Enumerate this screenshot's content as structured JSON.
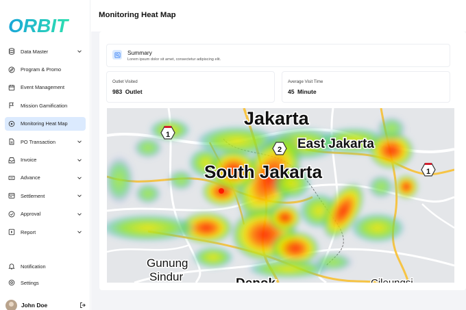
{
  "app": {
    "logo_text": "ORBIT"
  },
  "header": {
    "title": "Monitoring Heat Map"
  },
  "sidebar": {
    "items": [
      {
        "label": "Data Master",
        "icon": "database-icon",
        "has_chevron": true
      },
      {
        "label": "Program & Promo",
        "icon": "compass-icon",
        "has_chevron": false
      },
      {
        "label": "Event Management",
        "icon": "calendar-icon",
        "has_chevron": false
      },
      {
        "label": "Mission Gamification",
        "icon": "flag-icon",
        "has_chevron": false
      },
      {
        "label": "Monitoring Heat Map",
        "icon": "target-icon",
        "has_chevron": false,
        "active": true
      },
      {
        "label": "PO Transaction",
        "icon": "document-icon",
        "has_chevron": true
      },
      {
        "label": "Invoice",
        "icon": "inbox-icon",
        "has_chevron": true
      },
      {
        "label": "Advance",
        "icon": "cash-icon",
        "has_chevron": true
      },
      {
        "label": "Settlement",
        "icon": "card-icon",
        "has_chevron": true
      },
      {
        "label": "Approval",
        "icon": "check-circle-icon",
        "has_chevron": true
      },
      {
        "label": "Report",
        "icon": "report-icon",
        "has_chevron": true
      }
    ],
    "notification_label": "Notification",
    "settings_label": "Settings",
    "user": {
      "name": "John Doe"
    }
  },
  "summary": {
    "title": "Summary",
    "description": "Lorem ipsum dolor sit amet, consectetur adipiscing elit."
  },
  "stats": [
    {
      "label": "Outlet Visited",
      "value": "983  Outlet"
    },
    {
      "label": "Average Visit Time",
      "value": "45 Minute"
    }
  ],
  "map": {
    "labels": {
      "jakarta": "Jakarta",
      "east_jakarta": "East Jakarta",
      "south_jakarta": "South Jakarta",
      "gunung": "Gunung",
      "sindur": "Sindur",
      "depok": "Depok",
      "cileungsi": "Cileungsi"
    },
    "shields": [
      "1",
      "2",
      "1"
    ]
  },
  "colors": {
    "accent": "#1ec8c0",
    "active_bg": "#dbeafe",
    "heat_red": "#ff1a00",
    "heat_yellow": "#f2e600",
    "heat_green": "#7be02a"
  }
}
